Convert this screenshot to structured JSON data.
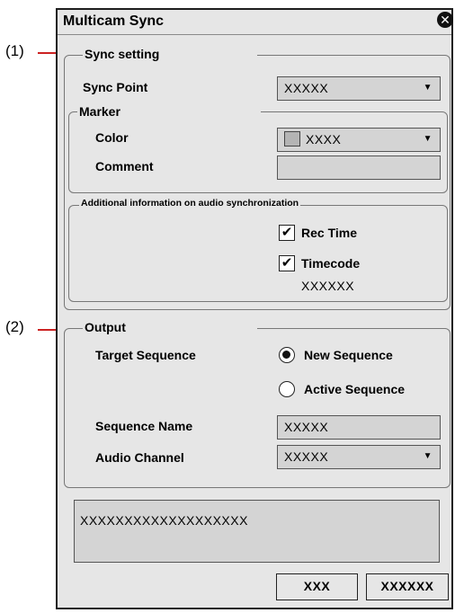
{
  "callouts": {
    "c1": "(1)",
    "c2": "(2)"
  },
  "dialog": {
    "title": "Multicam Sync"
  },
  "sync_setting": {
    "legend": "Sync setting",
    "sync_point_label": "Sync Point",
    "sync_point_value": "XXXXX",
    "marker": {
      "legend": "Marker",
      "color_label": "Color",
      "color_value": "XXXX",
      "comment_label": "Comment",
      "comment_value": ""
    },
    "audio_sync": {
      "legend": "Additional information on audio synchronization",
      "rec_time_label": "Rec Time",
      "rec_time_checked": true,
      "timecode_label": "Timecode",
      "timecode_checked": true,
      "timecode_value": "XXXXXX"
    }
  },
  "output": {
    "legend": "Output",
    "target_sequence_label": "Target Sequence",
    "new_sequence_label": "New Sequence",
    "active_sequence_label": "Active Sequence",
    "selected": "New Sequence",
    "sequence_name_label": "Sequence Name",
    "sequence_name_value": "XXXXX",
    "audio_channel_label": "Audio Channel",
    "audio_channel_value": "XXXXX"
  },
  "message": "XXXXXXXXXXXXXXXXXXX",
  "buttons": {
    "ok": "XXX",
    "cancel": "XXXXXX"
  },
  "icons": {
    "close": "close-icon",
    "check": "check-icon",
    "dropdown": "dropdown-arrow-icon"
  }
}
